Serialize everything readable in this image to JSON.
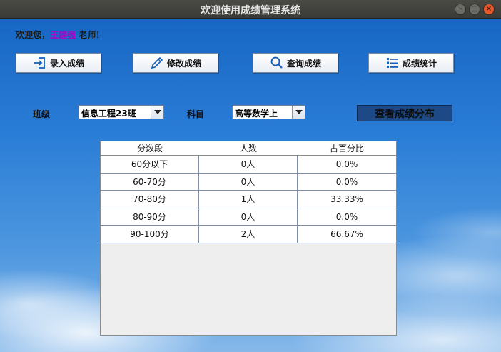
{
  "window": {
    "title": "欢迎使用成绩管理系统"
  },
  "welcome": {
    "prefix": "欢迎您，",
    "username": "王建强",
    "suffix": " 老师！"
  },
  "toolbar": {
    "enter_scores": "录入成绩",
    "edit_scores": "修改成绩",
    "query_scores": "查询成绩",
    "score_stats": "成绩统计"
  },
  "filters": {
    "class_label": "班级",
    "class_value": "信息工程23班",
    "subject_label": "科目",
    "subject_value": "高等数学上",
    "view_button": "查看成绩分布"
  },
  "table": {
    "headers": [
      "分数段",
      "人数",
      "占百分比"
    ],
    "rows": [
      [
        "60分以下",
        "0人",
        "0.0%"
      ],
      [
        "60-70分",
        "0人",
        "0.0%"
      ],
      [
        "70-80分",
        "1人",
        "33.33%"
      ],
      [
        "80-90分",
        "0人",
        "0.0%"
      ],
      [
        "90-100分",
        "2人",
        "66.67%"
      ]
    ]
  },
  "icons": {
    "enter_scores": "import-icon",
    "edit_scores": "pencil-icon",
    "query_scores": "search-icon",
    "score_stats": "list-icon"
  },
  "colors": {
    "accent": "#1d4a86",
    "username": "#b000c8",
    "close": "#e8582b"
  }
}
